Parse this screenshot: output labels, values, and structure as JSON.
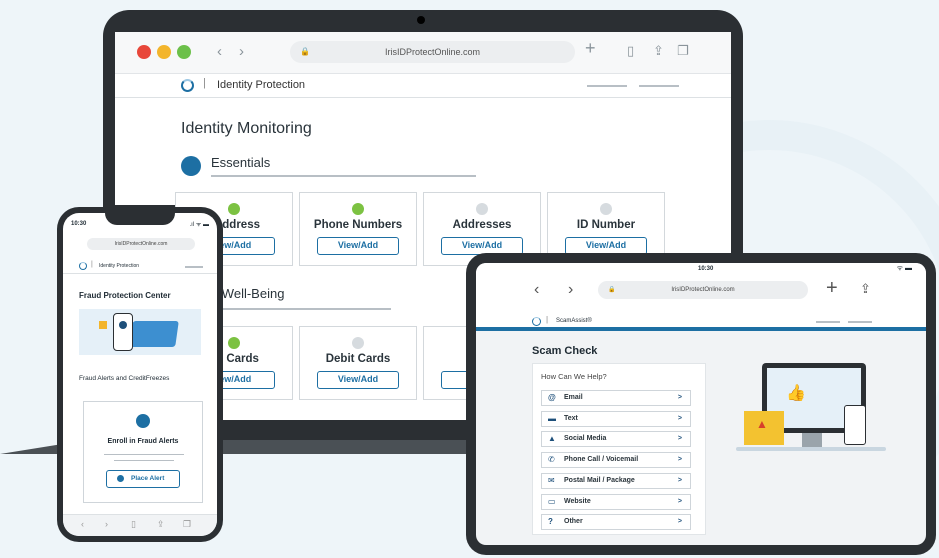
{
  "laptop": {
    "url": "IrisIDProtectOnline.com",
    "brand": "Identity Protection",
    "page_title": "Identity Monitoring",
    "section1": "Essentials",
    "section2": "nancial Well-Being",
    "cards_row1": [
      {
        "label": "l Address",
        "button": "iew/Add",
        "status": "green"
      },
      {
        "label": "Phone Numbers",
        "button": "View/Add",
        "status": "green"
      },
      {
        "label": "Addresses",
        "button": "View/Add",
        "status": "grey"
      },
      {
        "label": "ID Number",
        "button": "View/Add",
        "status": "grey"
      }
    ],
    "cards_row2": [
      {
        "label": "dit Cards",
        "button": "iew/Add",
        "status": "green"
      },
      {
        "label": "Debit Cards",
        "button": "View/Add",
        "status": "grey"
      },
      {
        "label": "Loya",
        "button": "Vi",
        "status": "grey"
      }
    ]
  },
  "phone": {
    "time": "10:30",
    "url": "IrisIDProtectOnline.com",
    "brand": "Identity Protection",
    "title": "Fraud Protection Center",
    "subtitle": "Fraud Alerts and CreditFreezes",
    "card_title": "Enroll in Fraud Alerts",
    "button": "Place Alert"
  },
  "tablet": {
    "time": "10:30",
    "url": "IrisIDProtectOnline.com",
    "brand": "ScamAssist®",
    "title": "Scam Check",
    "help_title": "How Can We Help?",
    "items": [
      {
        "label": "Email",
        "icon": "at-icon"
      },
      {
        "label": "Text",
        "icon": "chat-icon"
      },
      {
        "label": "Social Media",
        "icon": "thumbs-up-icon"
      },
      {
        "label": "Phone Call / Voicemail",
        "icon": "phone-icon"
      },
      {
        "label": "Postal Mail / Package",
        "icon": "mail-icon"
      },
      {
        "label": "Website",
        "icon": "monitor-icon"
      },
      {
        "label": "Other",
        "icon": "question-icon"
      }
    ]
  },
  "colors": {
    "accent": "#1d6fa3",
    "green": "#7cc242",
    "grey": "#d6dbdf"
  }
}
